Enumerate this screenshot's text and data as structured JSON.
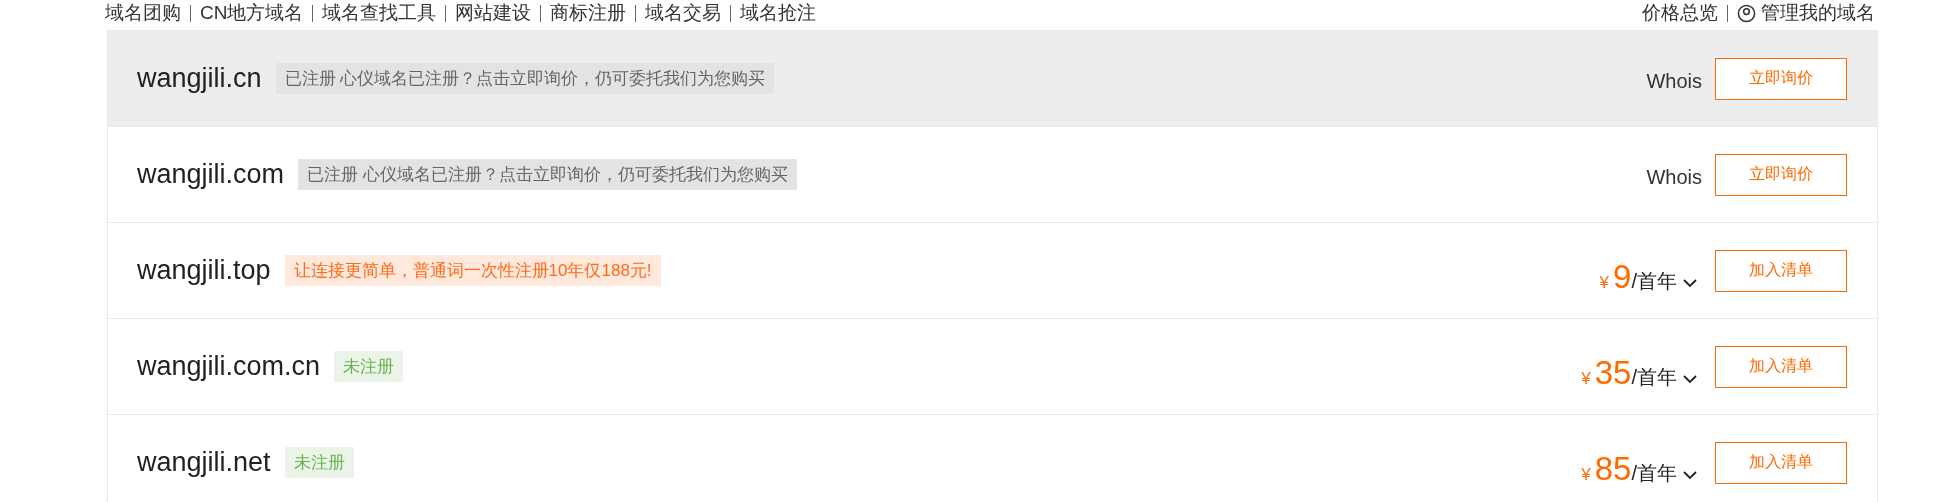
{
  "top_nav": {
    "links": [
      "域名团购",
      "CN地方域名",
      "域名查找工具",
      "网站建设",
      "商标注册",
      "域名交易",
      "域名抢注"
    ],
    "right_links": [
      "价格总览",
      "管理我的域名"
    ]
  },
  "results": [
    {
      "domain": "wangjili.cn",
      "badge": {
        "kind": "registered",
        "text": "已注册 心仪域名已注册？点击立即询价，仍可委托我们为您购买"
      },
      "highlighted": true,
      "whois": "Whois",
      "button": "立即询价"
    },
    {
      "domain": "wangjili.com",
      "badge": {
        "kind": "registered",
        "text": "已注册 心仪域名已注册？点击立即询价，仍可委托我们为您购买"
      },
      "highlighted": false,
      "whois": "Whois",
      "button": "立即询价"
    },
    {
      "domain": "wangjili.top",
      "badge": {
        "kind": "promo",
        "text": "让连接更简单，普通词一次性注册10年仅188元!"
      },
      "highlighted": false,
      "price": {
        "currency": "¥",
        "amount": "9",
        "unit": "/首年"
      },
      "button": "加入清单"
    },
    {
      "domain": "wangjili.com.cn",
      "badge": {
        "kind": "available",
        "text": "未注册"
      },
      "highlighted": false,
      "price": {
        "currency": "¥",
        "amount": "35",
        "unit": "/首年"
      },
      "button": "加入清单"
    },
    {
      "domain": "wangjili.net",
      "badge": {
        "kind": "available",
        "text": "未注册"
      },
      "highlighted": false,
      "price": {
        "currency": "¥",
        "amount": "85",
        "unit": "/首年"
      },
      "button": "加入清单"
    }
  ]
}
